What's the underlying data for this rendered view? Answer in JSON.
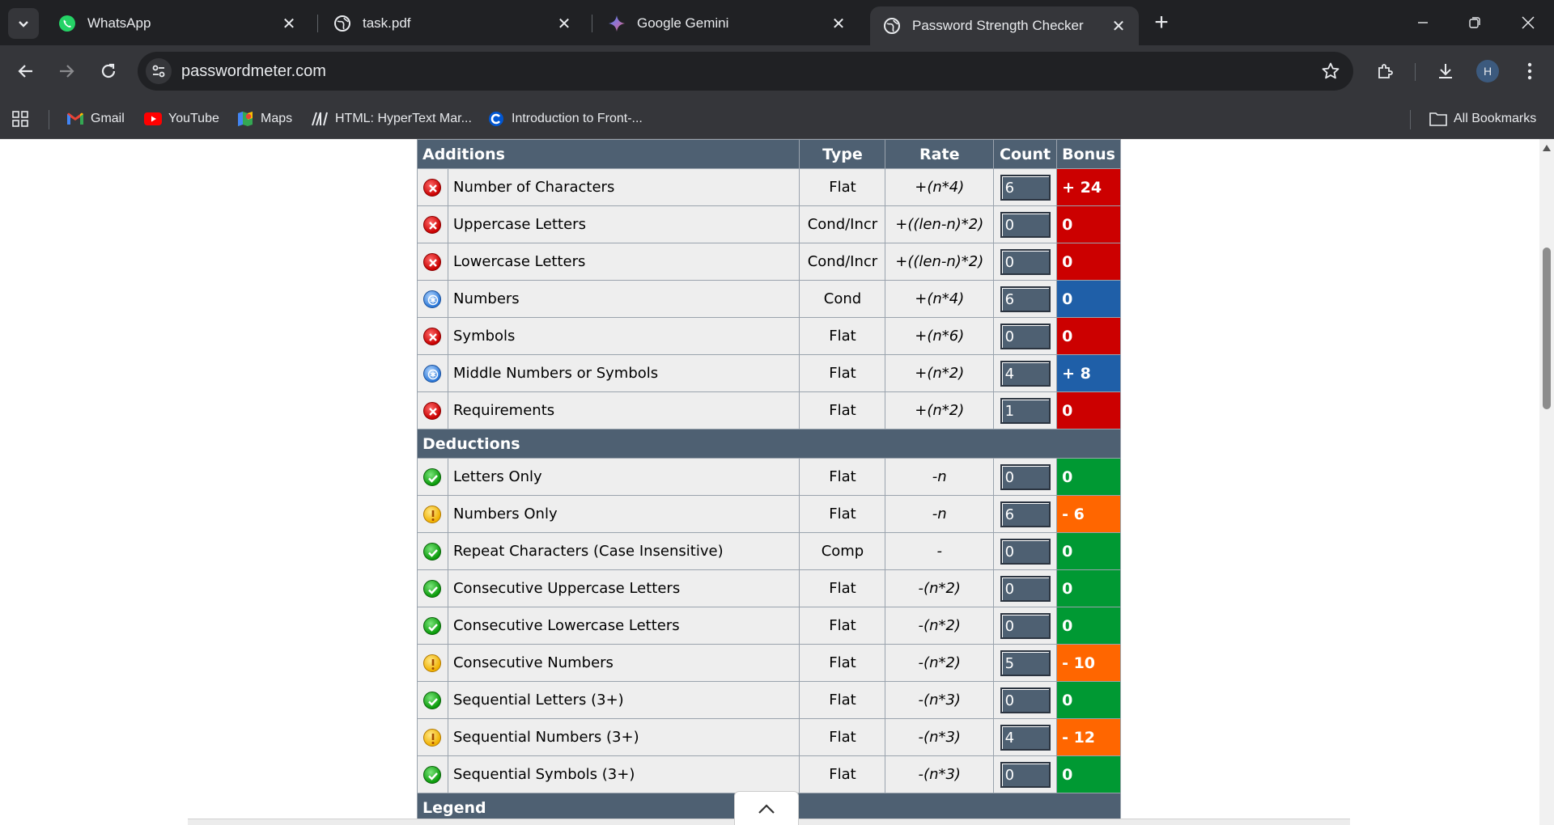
{
  "tabs": [
    {
      "title": "WhatsApp",
      "icon": "whatsapp-icon"
    },
    {
      "title": "task.pdf",
      "icon": "globe-icon"
    },
    {
      "title": "Google Gemini",
      "icon": "gemini-icon"
    },
    {
      "title": "Password Strength Checker",
      "icon": "globe-icon",
      "active": true
    }
  ],
  "omnibox": {
    "url": "passwordmeter.com"
  },
  "profile": {
    "initial": "H"
  },
  "bookmarks": [
    {
      "label": "Gmail",
      "icon": "gmail-icon"
    },
    {
      "label": "YouTube",
      "icon": "youtube-icon"
    },
    {
      "label": "Maps",
      "icon": "maps-icon"
    },
    {
      "label": "HTML: HyperText Mar...",
      "icon": "mdn-icon"
    },
    {
      "label": "Introduction to Front-...",
      "icon": "coursera-icon"
    }
  ],
  "all_bookmarks": "All Bookmarks",
  "table": {
    "headers": {
      "additions": "Additions",
      "type": "Type",
      "rate": "Rate",
      "count": "Count",
      "bonus": "Bonus"
    },
    "deductions_label": "Deductions",
    "legend_label": "Legend",
    "additions": [
      {
        "name": "Number of Characters",
        "type": "Flat",
        "rate": "+(n*4)",
        "count": "6",
        "bonus": "+ 24",
        "status": "fail"
      },
      {
        "name": "Uppercase Letters",
        "type": "Cond/Incr",
        "rate": "+((len-n)*2)",
        "count": "0",
        "bonus": "0",
        "status": "fail"
      },
      {
        "name": "Lowercase Letters",
        "type": "Cond/Incr",
        "rate": "+((len-n)*2)",
        "count": "0",
        "bonus": "0",
        "status": "fail"
      },
      {
        "name": "Numbers",
        "type": "Cond",
        "rate": "+(n*4)",
        "count": "6",
        "bonus": "0",
        "status": "exception"
      },
      {
        "name": "Symbols",
        "type": "Flat",
        "rate": "+(n*6)",
        "count": "0",
        "bonus": "0",
        "status": "fail"
      },
      {
        "name": "Middle Numbers or Symbols",
        "type": "Flat",
        "rate": "+(n*2)",
        "count": "4",
        "bonus": "+ 8",
        "status": "exception"
      },
      {
        "name": "Requirements",
        "type": "Flat",
        "rate": "+(n*2)",
        "count": "1",
        "bonus": "0",
        "status": "fail"
      }
    ],
    "deductions": [
      {
        "name": "Letters Only",
        "type": "Flat",
        "rate": "-n",
        "count": "0",
        "bonus": "0",
        "status": "ok"
      },
      {
        "name": "Numbers Only",
        "type": "Flat",
        "rate": "-n",
        "count": "6",
        "bonus": "- 6",
        "status": "warn"
      },
      {
        "name": "Repeat Characters (Case Insensitive)",
        "type": "Comp",
        "rate": "-",
        "count": "0",
        "bonus": "0",
        "status": "ok"
      },
      {
        "name": "Consecutive Uppercase Letters",
        "type": "Flat",
        "rate": "-(n*2)",
        "count": "0",
        "bonus": "0",
        "status": "ok"
      },
      {
        "name": "Consecutive Lowercase Letters",
        "type": "Flat",
        "rate": "-(n*2)",
        "count": "0",
        "bonus": "0",
        "status": "ok"
      },
      {
        "name": "Consecutive Numbers",
        "type": "Flat",
        "rate": "-(n*2)",
        "count": "5",
        "bonus": "- 10",
        "status": "warn"
      },
      {
        "name": "Sequential Letters (3+)",
        "type": "Flat",
        "rate": "-(n*3)",
        "count": "0",
        "bonus": "0",
        "status": "ok"
      },
      {
        "name": "Sequential Numbers (3+)",
        "type": "Flat",
        "rate": "-(n*3)",
        "count": "4",
        "bonus": "- 12",
        "status": "warn"
      },
      {
        "name": "Sequential Symbols (3+)",
        "type": "Flat",
        "rate": "-(n*3)",
        "count": "0",
        "bonus": "0",
        "status": "ok"
      }
    ]
  },
  "colors": {
    "fail": "#cc0000",
    "ok": "#009933",
    "warn": "#ff6600",
    "exception": "#1f5fa8",
    "header": "#4e6072"
  }
}
